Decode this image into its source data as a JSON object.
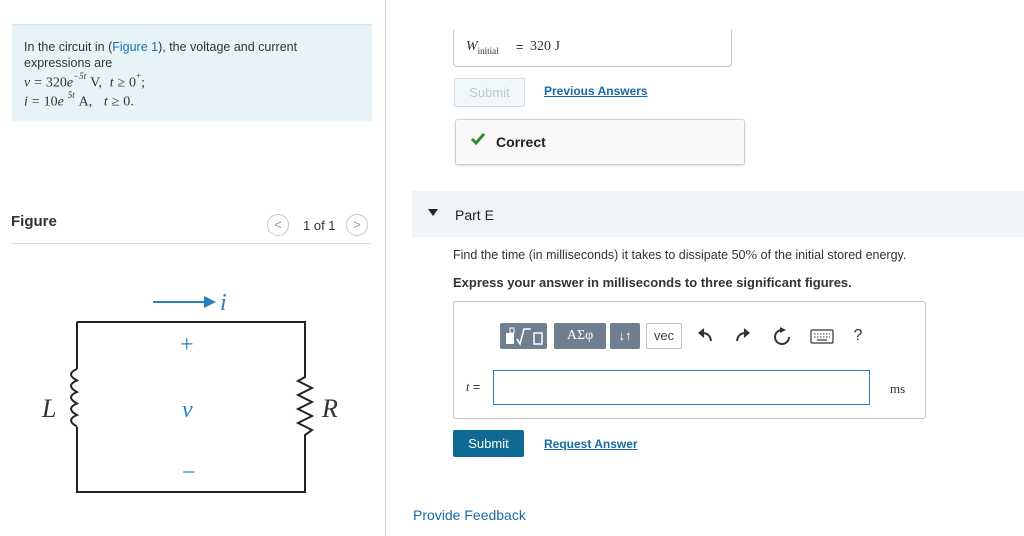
{
  "problem": {
    "intro_before": "In the circuit in (",
    "figure_link": "Figure 1",
    "intro_after": "), the voltage and current expressions are",
    "v_eq": {
      "lhs": "v",
      "eq": "=",
      "coef": "320",
      "base": "e",
      "exp": "−5t",
      "unit": "V,",
      "cond_var": "t",
      "cond_op": "≥",
      "cond_val": "0",
      "cond_sup": "+",
      "end": ";"
    },
    "i_eq": {
      "lhs": "i",
      "eq": "=",
      "coef": "10",
      "base": "e",
      "exp": "5t",
      "unit": "A,",
      "cond_var": "t",
      "cond_op": "≥",
      "cond_val": "0."
    }
  },
  "figure": {
    "title": "Figure",
    "pager": "1 of 1",
    "prev_glyph": "<",
    "next_glyph": ">",
    "labels": {
      "current": "i",
      "plus": "+",
      "voltage": "v",
      "minus": "−",
      "inductor": "L",
      "resistor": "R"
    }
  },
  "prev_part": {
    "field_symbol": "W",
    "field_subscript": "initial",
    "field_eq": "=",
    "field_value": "320 J",
    "submit_label": "Submit",
    "prev_answers_label": "Previous Answers",
    "correct_label": "Correct"
  },
  "partE": {
    "title": "Part E",
    "question_before": "Find the time (in milliseconds) it takes to dissipate 50",
    "question_pct": "%",
    "question_after": " of the initial stored energy.",
    "instruction": "Express your answer in milliseconds to three significant figures.",
    "toolbar": {
      "greek": "ΑΣφ",
      "arrows": "↓↑",
      "vec": "vec",
      "help": "?"
    },
    "var_label": "t",
    "var_eq": "=",
    "answer_value": "",
    "unit": "ms",
    "submit_label": "Submit",
    "request_label": "Request Answer"
  },
  "footer": {
    "feedback_label": "Provide Feedback"
  },
  "colors": {
    "accent": "#0f6a93",
    "link": "#1a6aa6",
    "correct_check": "#2e8b2e",
    "problem_bg": "#e6f4f7"
  }
}
